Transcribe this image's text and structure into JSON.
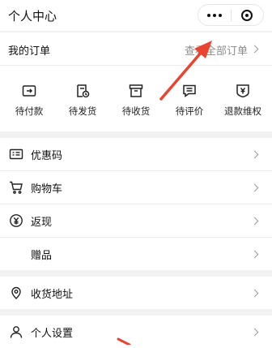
{
  "header": {
    "title": "个人中心"
  },
  "orders": {
    "title": "我的订单",
    "view_all": "查看全部订单",
    "items": [
      {
        "label": "待付款",
        "icon": "wallet-icon"
      },
      {
        "label": "待发货",
        "icon": "clock-document-icon"
      },
      {
        "label": "待收货",
        "icon": "box-icon"
      },
      {
        "label": "待评价",
        "icon": "comment-icon"
      },
      {
        "label": "退款维权",
        "icon": "refund-shield-icon"
      }
    ]
  },
  "group1": [
    {
      "label": "优惠码",
      "icon": "coupon-icon"
    },
    {
      "label": "购物车",
      "icon": "cart-icon"
    },
    {
      "label": "返现",
      "icon": "yuan-coin-icon"
    },
    {
      "label": "赠品",
      "icon": ""
    }
  ],
  "group2": [
    {
      "label": "收货地址",
      "icon": "location-pin-icon"
    }
  ],
  "group3": [
    {
      "label": "个人设置",
      "icon": "user-icon"
    }
  ],
  "annotation": {
    "color": "#e8442f"
  }
}
